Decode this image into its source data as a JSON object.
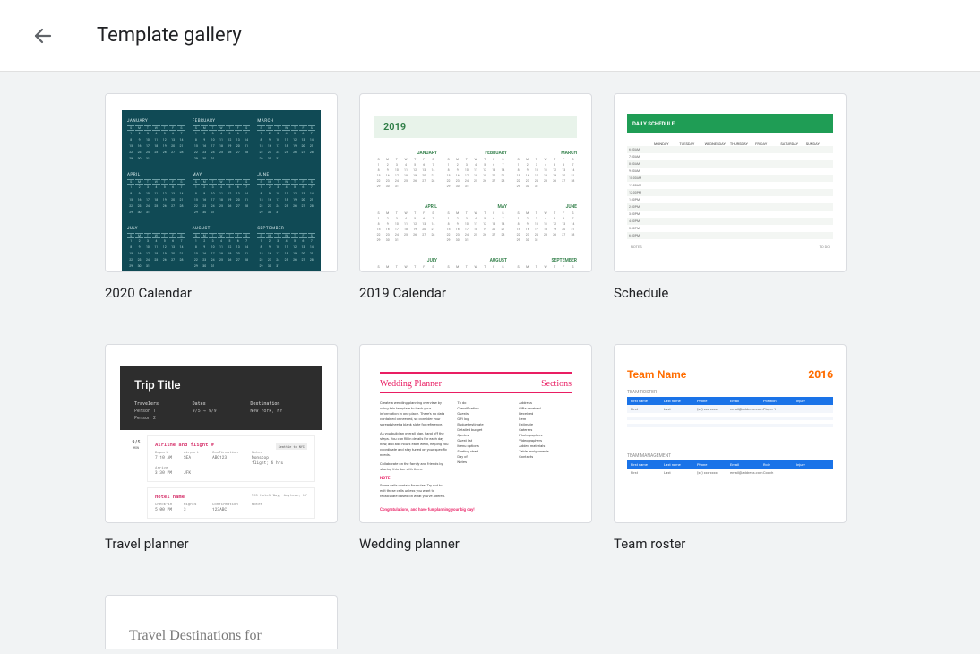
{
  "header": {
    "title": "Template gallery"
  },
  "templates": [
    {
      "label": "2020 Calendar"
    },
    {
      "label": "2019 Calendar"
    },
    {
      "label": "Schedule"
    },
    {
      "label": "Travel planner"
    },
    {
      "label": "Wedding planner"
    },
    {
      "label": "Team roster"
    },
    {
      "label": ""
    }
  ],
  "thumb_2020": {
    "months": [
      "JANUARY",
      "FEBRUARY",
      "MARCH",
      "APRIL",
      "MAY",
      "JUNE",
      "JULY",
      "AUGUST",
      "SEPTEMBER"
    ],
    "weekdays": [
      "S",
      "M",
      "T",
      "W",
      "T",
      "F",
      "S"
    ]
  },
  "thumb_2019": {
    "year": "2019",
    "months_row1": [
      "JANUARY",
      "FEBRUARY",
      "MARCH"
    ],
    "months_row2": [
      "APRIL",
      "MAY",
      "JUNE"
    ],
    "months_row3": [
      "JULY",
      "AUGUST",
      "SEPTEMBER"
    ]
  },
  "thumb_schedule": {
    "title": "DAILY SCHEDULE",
    "days": [
      "MONDAY",
      "TUESDAY",
      "WEDNESDAY",
      "THURSDAY",
      "FRIDAY",
      "SATURDAY",
      "SUNDAY"
    ],
    "foot_left": "NOTES",
    "foot_right": "TO DO"
  },
  "thumb_trip": {
    "title": "Trip Title",
    "meta_labels": [
      "Travelers",
      "Dates",
      "Destination"
    ],
    "meta_vals": [
      "Person 1",
      "9/5 → 9/9",
      "New York, NY"
    ],
    "meta_person2": "Person 2",
    "date_badge": "9/5",
    "date_badge_sub": "MON",
    "sec1_title": "Airline and flight #",
    "sec1_badge": "Seattle to NYC",
    "sec1_headers": [
      "Depart",
      "Airport",
      "Confirmation",
      "Notes"
    ],
    "sec1_row": [
      "7:10 AM",
      "SEA",
      "ABC123",
      "Nonstop flight; 6 hrs"
    ],
    "sec1_arrive": "Arrive",
    "sec1_arrive_row": [
      "3:30 PM",
      "JFK"
    ],
    "sec2_title": "Hotel name",
    "sec2_addr": "123 Hotel Way, Anytown, NY",
    "sec2_headers": [
      "Check-in",
      "Nights",
      "Confirmation",
      "Notes"
    ],
    "sec2_row": [
      "5:00 PM",
      "3",
      "123ABC",
      ""
    ]
  },
  "thumb_wedding": {
    "title": "Wedding Planner",
    "sections": "Sections",
    "col1": [
      "Create a wedding planning overview by using this template to track your information in one place. There's no data contained or needed, so consider your spreadsheet a blank slate for reference.",
      "As you build an overall plan, hand off the steps. You can fill in details for each day now, and add hours each week, helping you coordinate and stay tuned on your specific needs.",
      "Collaborate on the family and friends by sharing this doc with them."
    ],
    "note_h": "NOTE",
    "note": "Some cells contain formulas. Try not to edit those cells unless you want to recalculate based on what you've altered.",
    "congrats": "Congratulations, and have fun planning your big day!",
    "sec_items": [
      "To do",
      "Classification",
      "Guests",
      "Gift log",
      "Budget estimate",
      "Detailed budget",
      "Quotes",
      "Guest list",
      "Menu options",
      "Seating chart",
      "Day of",
      "Notes"
    ],
    "sec_items2": [
      "Address",
      "Gifts received",
      "Received",
      "Item",
      "Estimate",
      "Caterers",
      "Photographers",
      "Videographers",
      "Added materials",
      "Table assignments",
      "Contacts"
    ]
  },
  "thumb_team": {
    "name": "Team Name",
    "year": "2016",
    "sub1": "TEAM ROSTER",
    "sub2": "TEAM MANAGEMENT",
    "headers": [
      "First name",
      "Last name",
      "Phone",
      "Email",
      "Position",
      "Injury"
    ],
    "row": [
      "First",
      "Last",
      "(xx) xxx-xxxx",
      "email@address.com",
      "Player 1",
      ""
    ],
    "headers2": [
      "First name",
      "Last name",
      "Phone",
      "Email",
      "Role",
      "Injury"
    ],
    "row2": [
      "First",
      "Last",
      "(xx) xxx-xxxx",
      "email@address.com",
      "Coach",
      ""
    ]
  },
  "thumb_travel": {
    "title": "Travel Destinations for"
  }
}
